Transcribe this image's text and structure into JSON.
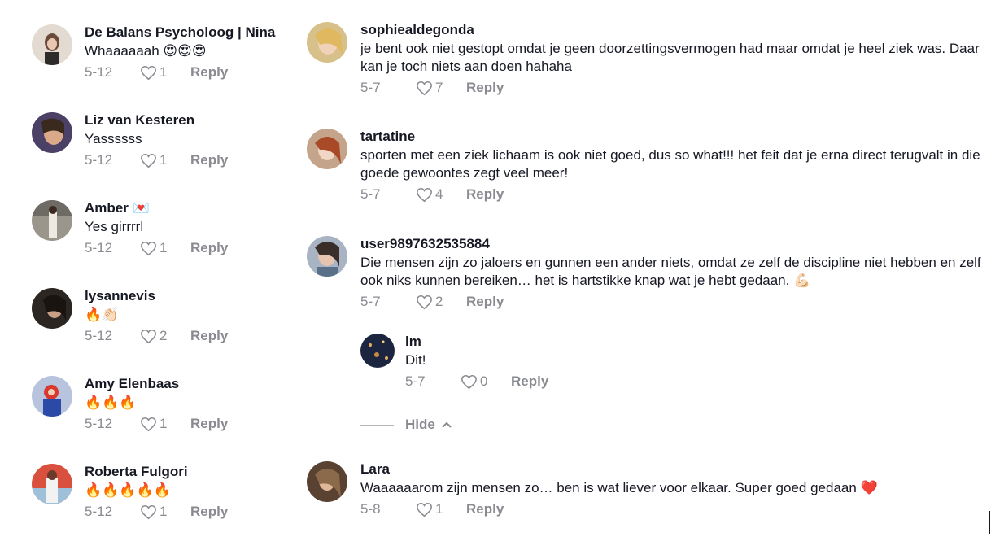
{
  "left_column": [
    {
      "username": "De Balans Psycholoog | Nina",
      "text": "Whaaaaaah 😍😍😍",
      "date": "5-12",
      "likes": "1",
      "reply": "Reply",
      "avatar_color": "#d9cfc6"
    },
    {
      "username": "Liz van Kesteren",
      "text": "Yassssss",
      "date": "5-12",
      "likes": "1",
      "reply": "Reply",
      "avatar_color": "#5a4c7c"
    },
    {
      "username": "Amber 💌",
      "text": "Yes girrrrl",
      "date": "5-12",
      "likes": "1",
      "reply": "Reply",
      "avatar_color": "#8a877f"
    },
    {
      "username": "lysannevis",
      "text": "🔥👏🏻",
      "date": "5-12",
      "likes": "2",
      "reply": "Reply",
      "avatar_color": "#4a3f35"
    },
    {
      "username": "Amy Elenbaas",
      "text": "🔥🔥🔥",
      "date": "5-12",
      "likes": "1",
      "reply": "Reply",
      "avatar_color": "#3856a8"
    },
    {
      "username": "Roberta Fulgori",
      "text": "🔥🔥🔥🔥🔥",
      "date": "5-12",
      "likes": "1",
      "reply": "Reply",
      "avatar_color": "#c6584a"
    }
  ],
  "right_column": [
    {
      "username": "sophiealdegonda",
      "text": "je bent ook niet gestopt omdat je geen doorzettingsvermogen had maar omdat je heel ziek was. Daar kan je toch niets aan doen hahaha",
      "date": "5-7",
      "likes": "7",
      "reply": "Reply",
      "avatar_color": "#c9ab6e"
    },
    {
      "username": "tartatine",
      "text": "sporten met een ziek lichaam is ook niet goed, dus so what!!! het feit dat je erna direct terugvalt in die goede gewoontes zegt veel meer!",
      "date": "5-7",
      "likes": "4",
      "reply": "Reply",
      "avatar_color": "#8b5a3c"
    },
    {
      "username": "user9897632535884",
      "text": "Die mensen zijn zo jaloers en gunnen een ander niets, omdat ze zelf de discipline niet hebben en zelf ook niks kunnen bereiken… het is hartstikke knap wat je hebt gedaan. 💪🏻",
      "date": "5-7",
      "likes": "2",
      "reply": "Reply",
      "avatar_color": "#6b7f98"
    },
    {
      "username": "Lara",
      "text": "Waaaaaarom zijn mensen zo… ben is wat liever voor elkaar. Super goed gedaan ❤️",
      "date": "5-8",
      "likes": "1",
      "reply": "Reply",
      "avatar_color": "#7b5c44"
    }
  ],
  "reply_thread": {
    "username": "lm",
    "text": "Dit!",
    "date": "5-7",
    "likes": "0",
    "reply": "Reply",
    "avatar_color": "#1d2a4a",
    "hide_label": "Hide"
  }
}
